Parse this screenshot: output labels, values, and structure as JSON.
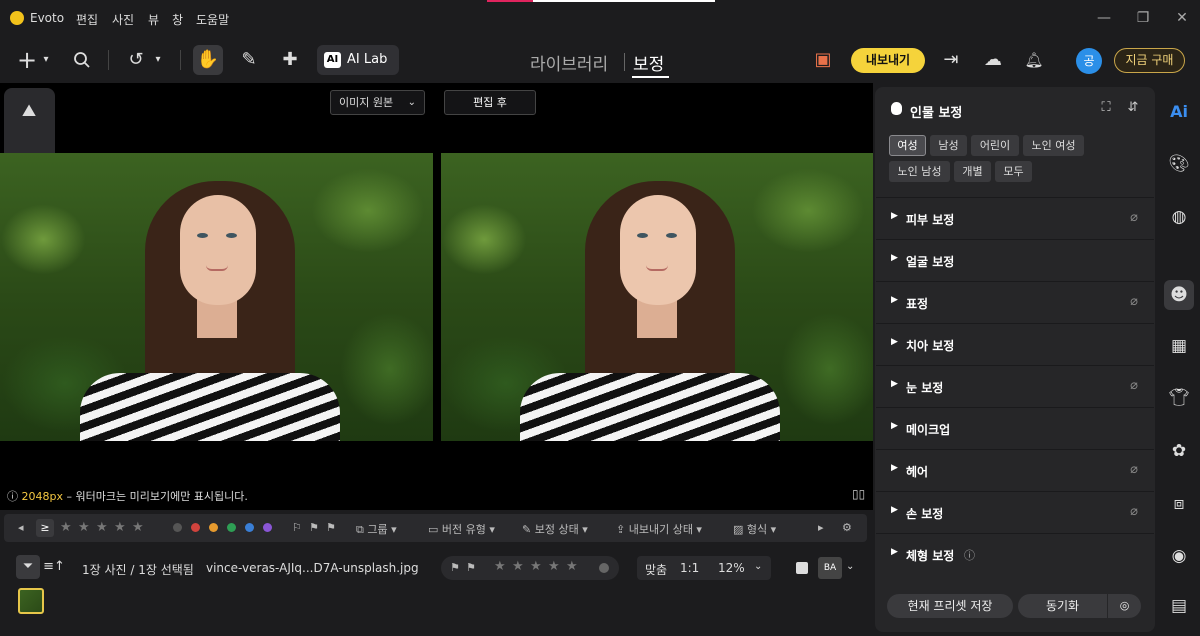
{
  "app": {
    "name": "Evoto"
  },
  "menu": [
    "편집",
    "사진",
    "뷰",
    "창",
    "도움말"
  ],
  "window_controls": {
    "minimize": "—",
    "maximize": "❐",
    "close": "✕"
  },
  "toolbar": {
    "ai_lab_label": "AI Lab",
    "ai_lab_icon": "AI",
    "modes": {
      "library": "라이브러리",
      "retouch": "보정"
    },
    "export_label": "내보내기",
    "avatar_label": "공",
    "buy_label": "지금 구매"
  },
  "canvas": {
    "compare_select": "이미지 원본",
    "compare_after": "편집 후",
    "watermark_px": "2048px",
    "watermark_text": " – 워터마크는 미리보기에만 표시됩니다."
  },
  "filterbar": {
    "ge_symbol": "≥",
    "colors": [
      "#555555",
      "#d0433d",
      "#e69a2e",
      "#2e9e54",
      "#3a7fd6",
      "#8a56d6"
    ],
    "group": "그룹",
    "version_type": "버전 유형",
    "retouch_status": "보정 상태",
    "export_status": "내보내기 상태",
    "format": "형식"
  },
  "status": {
    "selection": "1장 사진 / 1장 선택됨",
    "filename": "vince-veras-AJIq...D7A-unsplash.jpg",
    "zoom_fit": "맞춤",
    "zoom_1to1": "1:1",
    "zoom_pct": "12%",
    "view_ba": "BA"
  },
  "right_panel": {
    "title": "인물 보정",
    "chips": [
      "여성",
      "남성",
      "어린이",
      "노인 여성",
      "노인 남성",
      "개별",
      "모두"
    ],
    "active_chip": "여성",
    "sections": [
      {
        "label": "피부 보정",
        "reset": true
      },
      {
        "label": "얼굴 보정",
        "reset": false
      },
      {
        "label": "표정",
        "reset": true
      },
      {
        "label": "치아 보정",
        "reset": false
      },
      {
        "label": "눈 보정",
        "reset": true
      },
      {
        "label": "메이크업",
        "reset": false
      },
      {
        "label": "헤어",
        "reset": true
      },
      {
        "label": "손 보정",
        "reset": true
      },
      {
        "label": "체형 보정",
        "reset": false
      }
    ],
    "save_preset": "현재 프리셋 저장",
    "sync": "동기화"
  },
  "far_right": {
    "ai_label": "Ai"
  }
}
